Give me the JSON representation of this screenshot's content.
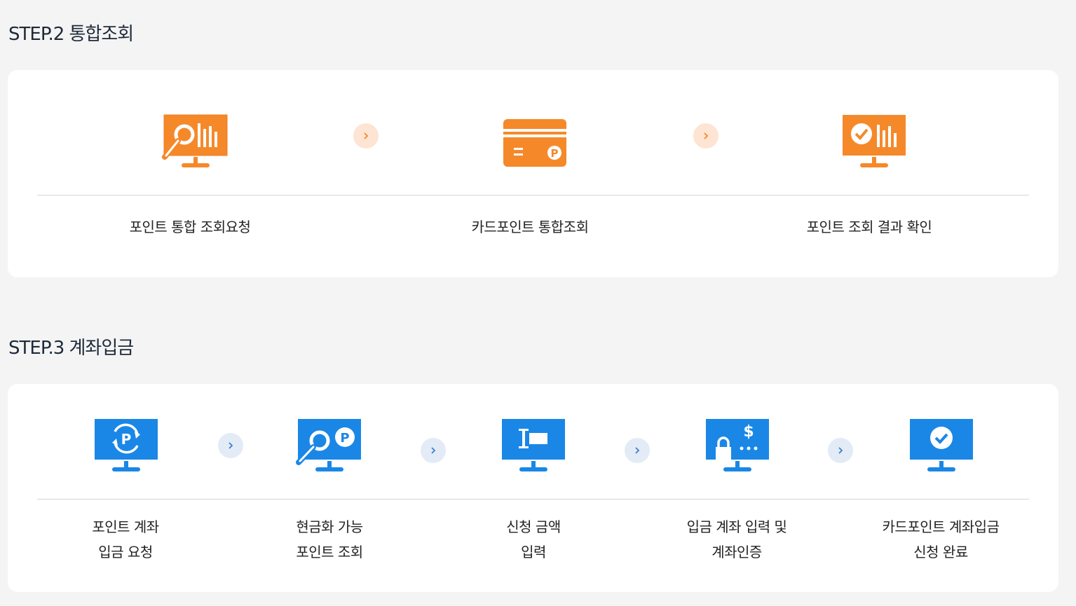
{
  "step2": {
    "title": "STEP.2 통합조회",
    "steps": [
      {
        "label": "포인트 통합 조회요청",
        "icon": "monitor-search-chart-icon"
      },
      {
        "label": "카드포인트 통합조회",
        "icon": "card-point-icon"
      },
      {
        "label": "포인트 조회 결과 확인",
        "icon": "monitor-check-chart-icon"
      }
    ]
  },
  "step3": {
    "title": "STEP.3 계좌입금",
    "steps": [
      {
        "line1": "포인트 계좌",
        "line2": "입금 요청",
        "icon": "monitor-point-refresh-icon"
      },
      {
        "line1": "현금화 가능",
        "line2": "포인트 조회",
        "icon": "monitor-search-point-icon"
      },
      {
        "line1": "신청 금액",
        "line2": "입력",
        "icon": "monitor-input-icon"
      },
      {
        "line1": "입금 계좌 입력 및",
        "line2": "계좌인증",
        "icon": "monitor-lock-dollar-icon"
      },
      {
        "line1": "카드포인트 계좌입금",
        "line2": "신청 완료",
        "icon": "monitor-check-icon"
      }
    ]
  },
  "colors": {
    "orange": "#f5892a",
    "blue": "#1a87e6",
    "orange_arrow_bg": "#fde4d3",
    "blue_arrow_bg": "#e3ebf6",
    "orange_arrow": "#f5892a",
    "blue_arrow": "#3d7fd1"
  }
}
